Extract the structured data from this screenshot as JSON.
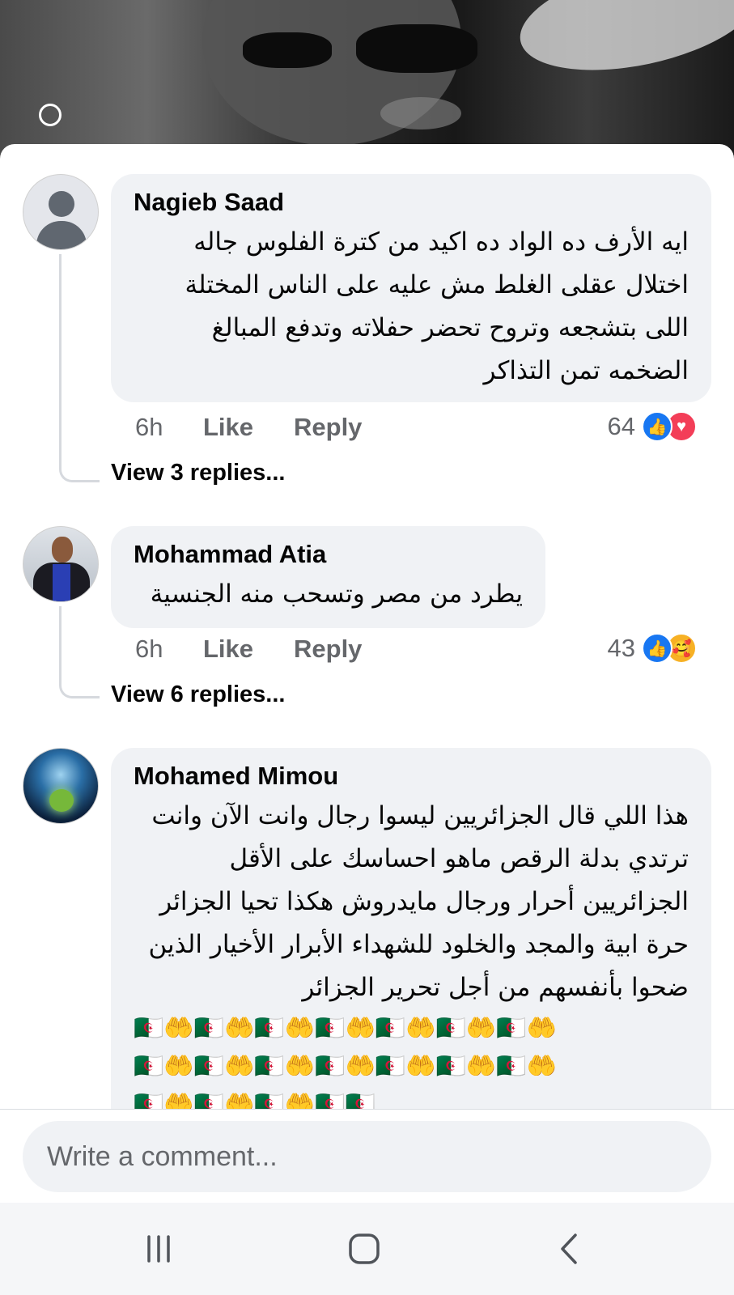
{
  "colors": {
    "sheet_bg": "#ffffff",
    "bubble_bg": "#f0f2f5",
    "secondary_text": "#65676b",
    "like_blue": "#1877f2",
    "love_red": "#f33e58",
    "care_yellow": "#f7b125",
    "nav_bg": "#f5f6f8"
  },
  "background": {
    "icon": "watermark-logo-icon"
  },
  "comments": [
    {
      "author": "Nagieb Saad",
      "avatar": "default-avatar-icon",
      "text": "ايه الأرف ده الواد ده اكيد من كترة الفلوس جاله اختلال عقلى الغلط مش عليه على الناس المختلة اللى بتشجعه وتروح تحضر حفلاته وتدفع المبالغ الضخمه تمن التذاكر",
      "time": "6h",
      "like_label": "Like",
      "reply_label": "Reply",
      "reaction_count": "64",
      "reactions": [
        "like-reaction-icon",
        "love-reaction-icon"
      ],
      "view_replies": "View 3 replies..."
    },
    {
      "author": "Mohammad Atia",
      "avatar": "profile-photo",
      "text": "يطرد من مصر وتسحب منه الجنسية",
      "time": "6h",
      "like_label": "Like",
      "reply_label": "Reply",
      "reaction_count": "43",
      "reactions": [
        "like-reaction-icon",
        "care-reaction-icon"
      ],
      "view_replies": "View 6 replies..."
    },
    {
      "author": "Mohamed Mimou",
      "avatar": "profile-photo",
      "text": "هذا اللي قال الجزائريين ليسوا رجال وانت الآن وانت ترتدي بدلة الرقص ماهو احساسك على الأقل الجزائريين أحرار ورجال مايدروش هكذا تحيا الجزائر حرة ابية والمجد والخلود للشهداء الأبرار الأخيار الذين ضحوا بأنفسهم من أجل تحرير الجزائر",
      "emoji_rows": [
        "🇩🇿🤲🇩🇿🤲🇩🇿🤲🇩🇿🤲🇩🇿🤲🇩🇿🤲🇩🇿🤲",
        "🇩🇿🤲🇩🇿🤲🇩🇿🤲🇩🇿🤲🇩🇿🤲🇩🇿🤲🇩🇿🤲",
        "🇩🇿🤲🇩🇿🤲🇩🇿🤲🇩🇿🇩🇿"
      ]
    }
  ],
  "composer": {
    "placeholder": "Write a comment..."
  },
  "navbar": {
    "recent_apps": "recent-apps-icon",
    "home": "home-icon",
    "back": "back-icon"
  }
}
